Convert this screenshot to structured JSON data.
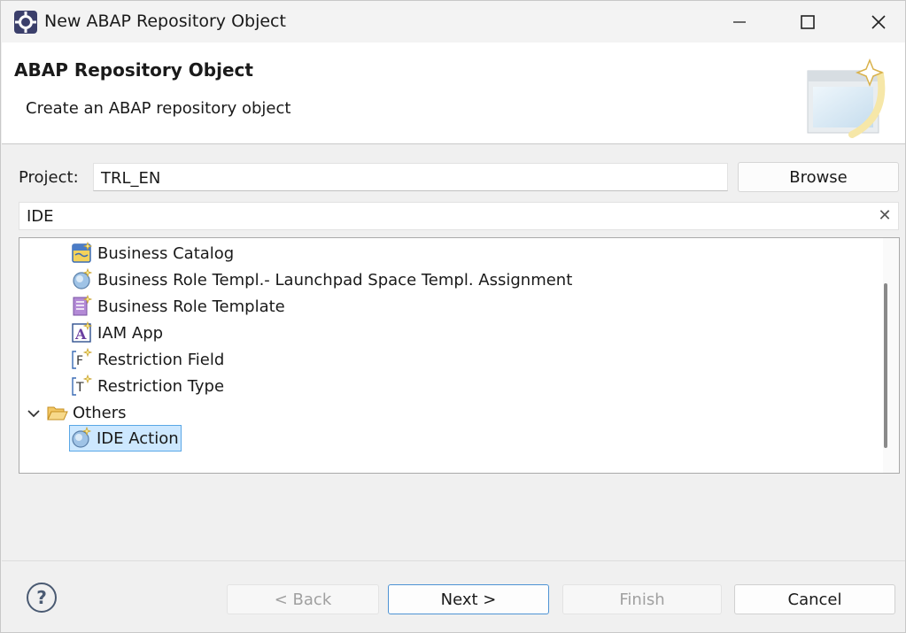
{
  "window": {
    "title": "New ABAP Repository Object",
    "minimize_icon": "minimize-icon",
    "maximize_icon": "maximize-icon",
    "close_icon": "close-icon"
  },
  "header": {
    "title": "ABAP Repository Object",
    "subtitle": "Create an ABAP repository object"
  },
  "project": {
    "label": "Project:",
    "value": "TRL_EN",
    "browse_label": "Browse"
  },
  "filter": {
    "value": "IDE"
  },
  "tree": {
    "items": [
      {
        "label": "Business Catalog",
        "icon": "business-catalog-icon"
      },
      {
        "label": "Business Role Templ.- Launchpad Space Templ. Assignment",
        "icon": "assignment-icon"
      },
      {
        "label": "Business Role Template",
        "icon": "business-role-template-icon"
      },
      {
        "label": "IAM App",
        "icon": "iam-app-icon"
      },
      {
        "label": "Restriction Field",
        "icon": "restriction-field-icon"
      },
      {
        "label": "Restriction Type",
        "icon": "restriction-type-icon"
      }
    ],
    "folder": {
      "label": "Others",
      "icon": "folder-open-icon",
      "expanded": true
    },
    "selected": {
      "label": "IDE Action",
      "icon": "ide-action-icon"
    }
  },
  "footer": {
    "back_label": "< Back",
    "next_label": "Next >",
    "finish_label": "Finish",
    "cancel_label": "Cancel",
    "help_icon": "help-icon"
  },
  "colors": {
    "accent": "#4e93d4",
    "selection": "#cde8ff",
    "disabled_text": "#a0a0a0"
  }
}
